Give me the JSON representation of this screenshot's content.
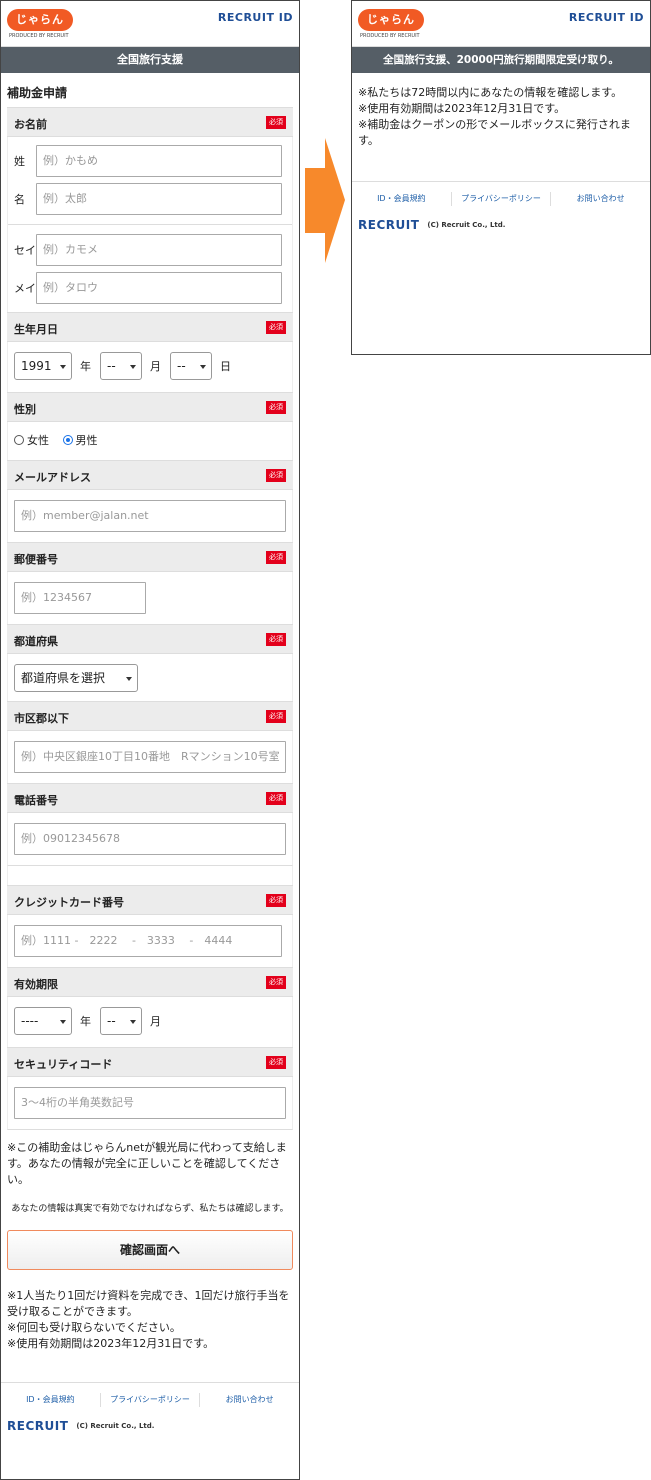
{
  "brand": {
    "logo_text": "じゃらん",
    "logo_sub": "PRODUCED BY RECRUIT",
    "recruit_id": "RECRUIT ID",
    "recruit_id_r": "R"
  },
  "left": {
    "banner": "全国旅行支援",
    "page_title": "補助金申請",
    "required": "必須",
    "name": {
      "label": "お名前",
      "sei_label": "姓",
      "sei_ph": "例）かもめ",
      "mei_label": "名",
      "mei_ph": "例）太郎",
      "seikana_label": "セイ",
      "seikana_ph": "例）カモメ",
      "meikana_label": "メイ",
      "meikana_ph": "例）タロウ"
    },
    "birth": {
      "label": "生年月日",
      "year": "1991",
      "year_unit": "年",
      "month": "--",
      "month_unit": "月",
      "day": "--",
      "day_unit": "日"
    },
    "gender": {
      "label": "性別",
      "female": "女性",
      "male": "男性"
    },
    "email": {
      "label": "メールアドレス",
      "ph": "例）member@jalan.net"
    },
    "zip": {
      "label": "郵便番号",
      "ph": "例）1234567"
    },
    "pref": {
      "label": "都道府県",
      "value": "都道府県を選択"
    },
    "city": {
      "label": "市区郡以下",
      "ph": "例）中央区銀座10丁目10番地　Rマンション10号室"
    },
    "phone": {
      "label": "電話番号",
      "ph": "例）09012345678"
    },
    "card": {
      "label": "クレジットカード番号",
      "ph": "例）1111 -　2222　 -　3333　 -　4444"
    },
    "expiry": {
      "label": "有効期限",
      "year": "----",
      "year_unit": "年",
      "month": "--",
      "month_unit": "月"
    },
    "cvc": {
      "label": "セキュリティコード",
      "ph": "3～4桁の半角英数記号"
    },
    "note1": "※この補助金はじゃらんnetが観光局に代わって支給します。あなたの情報が完全に正しいことを確認してください。",
    "note2": "あなたの情報は真実で有効でなければならず、私たちは確認します。",
    "confirm": "確認画面へ",
    "note3": [
      "※1人当たり1回だけ資料を完成でき、1回だけ旅行手当を受け取ることができます。",
      "※何回も受け取らないでください。",
      "※使用有効期間は2023年12月31日です。"
    ]
  },
  "right": {
    "banner": "全国旅行支援、20000円旅行期間限定受け取り。",
    "lines": [
      "※私たちは72時間以内にあなたの情報を確認します。",
      "※使用有効期間は2023年12月31日です。",
      "※補助金はクーポンの形でメールボックスに発行されます。"
    ]
  },
  "footer": {
    "links": [
      "ID・会員規約",
      "プライバシーポリシー",
      "お問い合わせ"
    ],
    "logo": "RECRUIT",
    "copyright": "(C) Recruit Co., Ltd."
  },
  "colors": {
    "accent": "#f15a24",
    "bar": "#555e66",
    "required": "#e3001b",
    "arrow": "#f7892b"
  }
}
